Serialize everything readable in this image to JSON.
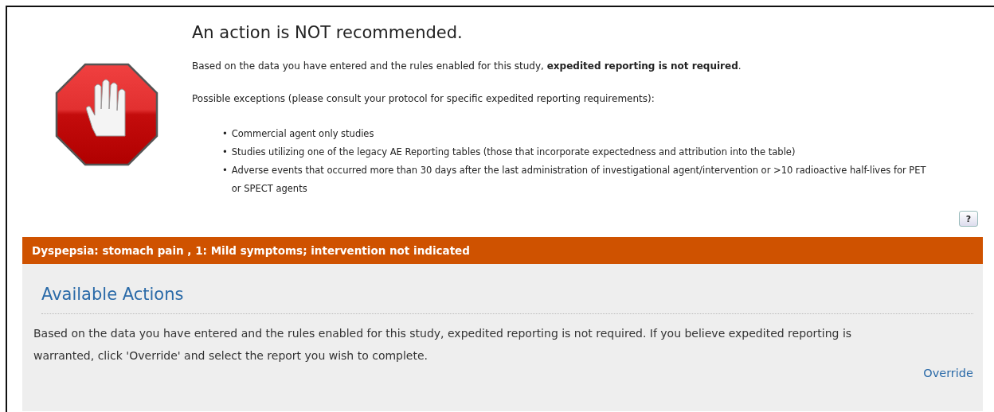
{
  "result": {
    "title": "An action is NOT recommended.",
    "summary": "Based on the data you have entered and the rules enabled for this study, **expedited reporting is not required**.",
    "exceptions_intro": "Possible exceptions (please consult your protocol for specific expedited reporting requirements):",
    "exceptions": [
      {
        "bullet": "•",
        "text": "Commercial agent only studies"
      },
      {
        "bullet": "•",
        "text": "Studies utilizing one of the legacy AE Reporting tables (those that incorporate expectedness and attribution into the table)"
      },
      {
        "bullet": "•",
        "text": "Adverse events that occurred more than 30 days after the last administration of investigational agent/intervention or >10 radioactive half-lives for PET or SPECT agents"
      }
    ],
    "help": "?"
  },
  "event_bar": "Dyspepsia: stomach pain , 1: Mild symptoms; intervention not indicated",
  "actions": {
    "heading": "Available Actions",
    "text": "Based on the data you have entered and the rules enabled for this study, expedited reporting is not required. If you believe expedited reporting is warranted, click 'Override' and select the report you wish to complete.",
    "link": "Override"
  }
}
